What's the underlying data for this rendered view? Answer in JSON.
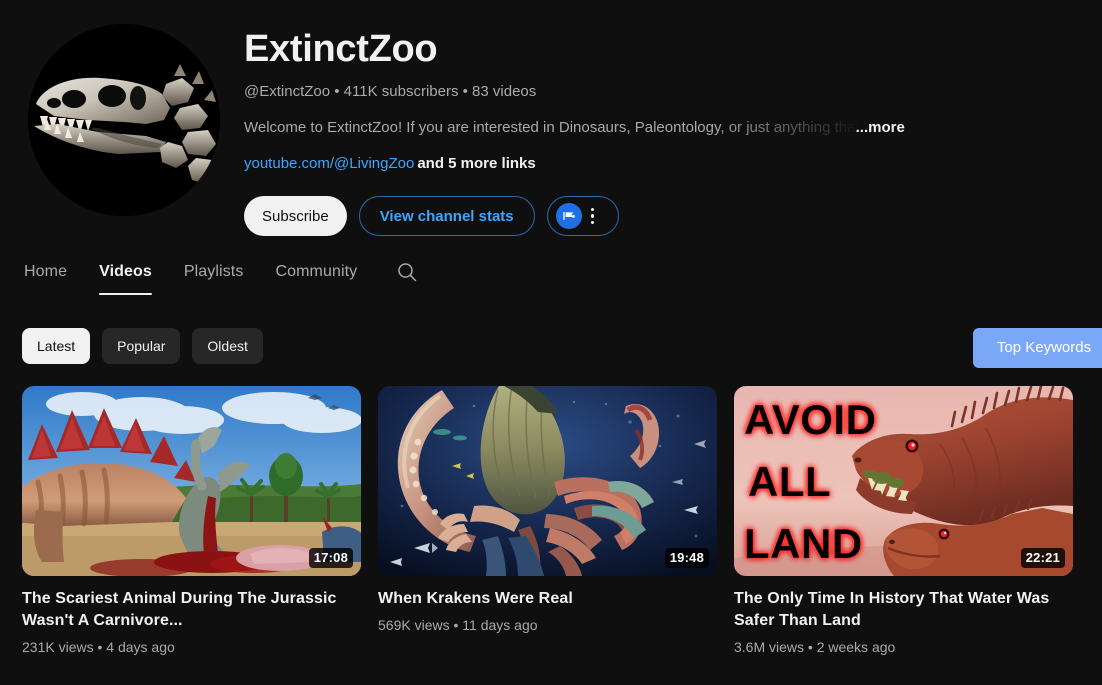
{
  "channel": {
    "name": "ExtinctZoo",
    "handle": "@ExtinctZoo",
    "subscribers": "411K subscribers",
    "videos_count": "83 videos",
    "meta_line": "@ExtinctZoo • 411K subscribers • 83 videos",
    "description": "Welcome to ExtinctZoo! If you are interested in Dinosaurs, Paleontology, or just anything that",
    "more_label": "...more",
    "primary_link": "youtube.com/@LivingZoo",
    "more_links_label": "and 5 more links",
    "avatar_icon": "dinosaur-skull-avatar"
  },
  "actions": {
    "subscribe_label": "Subscribe",
    "stats_label": "View channel stats",
    "badge_icon": "channel-analytics-badge-icon",
    "kebab_icon": "more-options-icon"
  },
  "tabs": [
    {
      "label": "Home",
      "active": false
    },
    {
      "label": "Videos",
      "active": true
    },
    {
      "label": "Playlists",
      "active": false
    },
    {
      "label": "Community",
      "active": false
    }
  ],
  "search": {
    "icon": "search-icon"
  },
  "filters": {
    "chips": [
      {
        "label": "Latest",
        "selected": true
      },
      {
        "label": "Popular",
        "selected": false
      },
      {
        "label": "Oldest",
        "selected": false
      }
    ]
  },
  "top_keywords": {
    "line1": "Top",
    "line2": "Keywords",
    "color": "#7aa7f7"
  },
  "videos": [
    {
      "title": "The Scariest Animal During The Jurassic Wasn't A Carnivore...",
      "views": "231K views",
      "age": "4 days ago",
      "meta": "231K views • 4 days ago",
      "duration": "17:08",
      "thumbnail": "stegosaurus-kill-scene"
    },
    {
      "title": "When Krakens Were Real",
      "views": "569K views",
      "age": "11 days ago",
      "meta": "569K views • 11 days ago",
      "duration": "19:48",
      "thumbnail": "underwater-kraken-scene"
    },
    {
      "title": "The Only Time In History That Water Was Safer Than Land",
      "views": "3.6M views",
      "age": "2 weeks ago",
      "meta": "3.6M views • 2 weeks ago",
      "duration": "22:21",
      "thumbnail": "avoid-all-land-theropods",
      "overlay_text": [
        "AVOID",
        "ALL",
        "LAND"
      ]
    }
  ],
  "theme": {
    "background": "#0f0f0f",
    "text_primary": "#f1f1f1",
    "text_secondary": "#aaaaaa",
    "link_blue": "#3ea6ff",
    "chip_bg": "#272727"
  }
}
